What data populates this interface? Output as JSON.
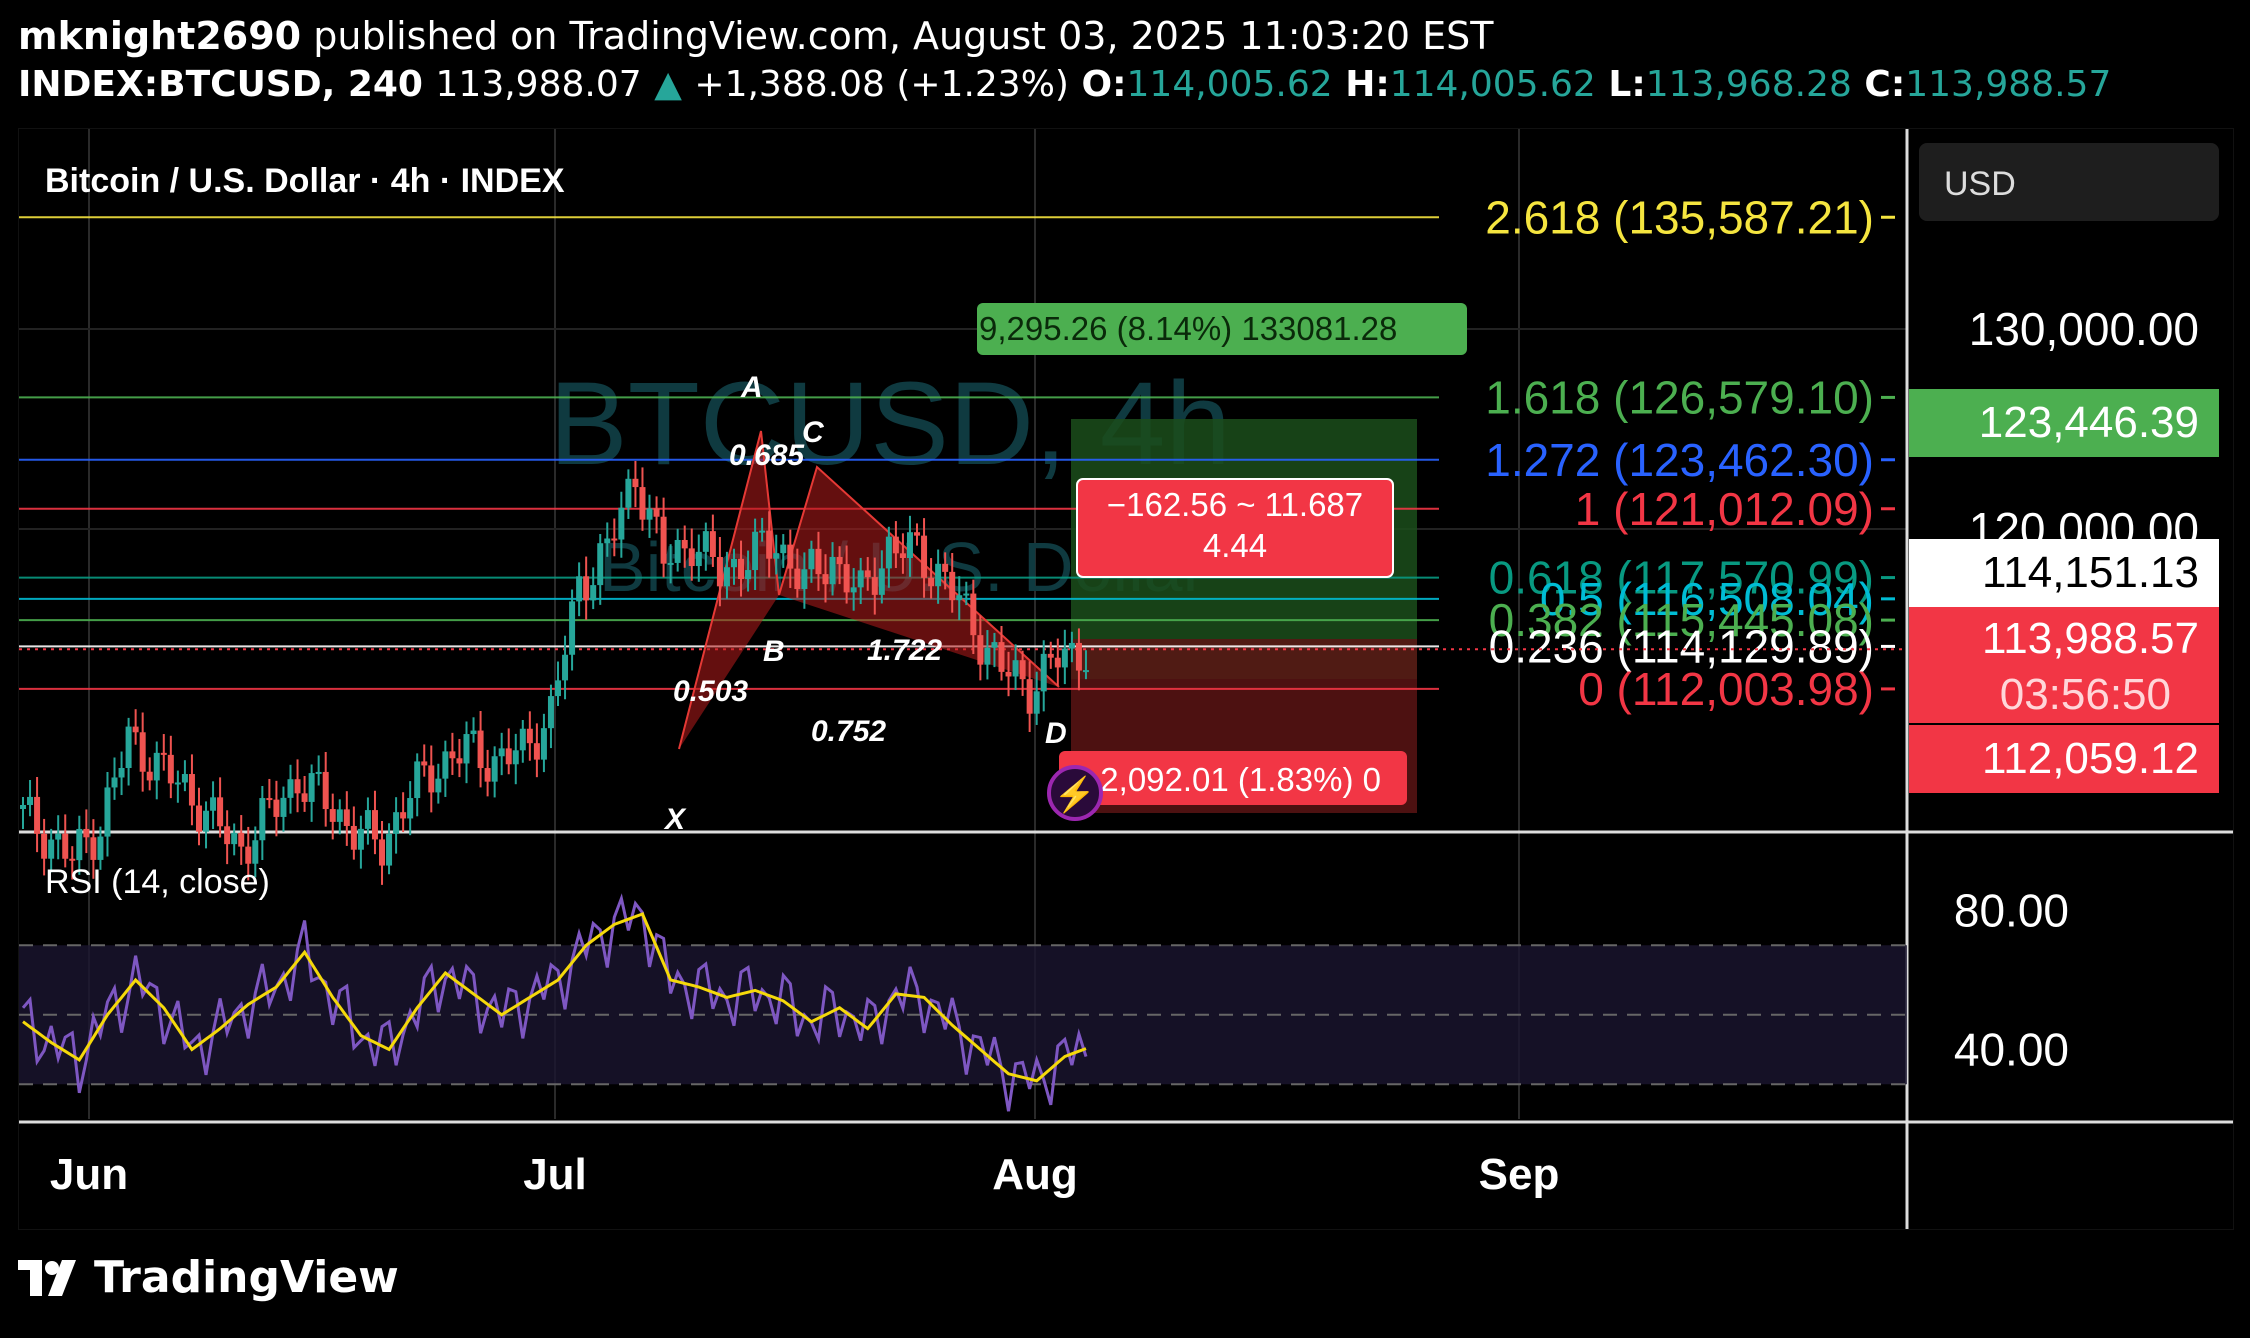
{
  "header": {
    "author": "mknight2690",
    "published_text": "published on TradingView.com, August 03, 2025 11:03:20 EST",
    "symbol": "INDEX:BTCUSD, 240",
    "last": "113,988.07",
    "change_arrow": "▲",
    "change": "+1,388.08 (+1.23%)",
    "o_label": "O:",
    "o": "114,005.62",
    "h_label": "H:",
    "h": "114,005.62",
    "l_label": "L:",
    "l": "113,968.28",
    "c_label": "C:",
    "c": "113,988.57"
  },
  "chart_title": "Bitcoin / U.S. Dollar · 4h · INDEX",
  "watermark": {
    "line1": "BTCUSD, 4h",
    "line2": "Bitcoin / U.S. Dollar"
  },
  "currency_button": "USD",
  "rsi_label": "RSI (14, close)",
  "pattern_labels": {
    "X": "X",
    "A": "A",
    "B": "B",
    "C": "C",
    "D": "D",
    "r_xab": "0.503",
    "r_abc": "0.685",
    "r_bcd": "1.722",
    "r_xad": "0.752"
  },
  "position_boxes": {
    "target": "9,295.26 (8.14%) 133081.28",
    "stop": "−162.56 ~ 11.687",
    "stop_ratio": "4.44",
    "stop_bottom": "2,092.01 (1.83%) 0"
  },
  "fib_levels": [
    {
      "label": "2.618 (135,587.21)",
      "price": 135587.21,
      "color": "#f5e53f"
    },
    {
      "label": "1.618 (126,579.10)",
      "price": 126579.1,
      "color": "#4caf50"
    },
    {
      "label": "1.272 (123,462.30)",
      "price": 123462.3,
      "color": "#2962ff"
    },
    {
      "label": "1 (121,012.09)",
      "price": 121012.09,
      "color": "#f23645"
    },
    {
      "label": "0.618 (117,570.99)",
      "price": 117570.99,
      "color": "#089981"
    },
    {
      "label": "0.5 (116,508.04)",
      "price": 116508.04,
      "color": "#00bcd4"
    },
    {
      "label": "0.382 (115,445.08)",
      "price": 115445.08,
      "color": "#4caf50"
    },
    {
      "label": "0.236 (114,129.89)",
      "price": 114129.89,
      "color": "#ffffff"
    },
    {
      "label": "0 (112,003.98)",
      "price": 112003.98,
      "color": "#f23645"
    }
  ],
  "price_axis": [
    {
      "label": "130,000.00",
      "price": 130000
    },
    {
      "label": "120,000.00",
      "price": 120000
    }
  ],
  "price_tags": {
    "green": "123,446.39",
    "white": "114,151.13",
    "red_price": "113,988.57",
    "red_timer": "03:56:50",
    "red_low": "112,059.12"
  },
  "rsi_axis": [
    {
      "label": "80.00",
      "value": 80
    },
    {
      "label": "40.00",
      "value": 40
    }
  ],
  "time_axis": [
    "Jun",
    "Jul",
    "Aug",
    "Sep"
  ],
  "footer": {
    "brand": "TradingView"
  },
  "colors": {
    "up": "#26a69a",
    "down": "#ef5350",
    "rsi": "#7e57c2",
    "rsi_ma": "#f5d90a",
    "pattern": "#b71c1c"
  },
  "chart_data": {
    "type": "line",
    "title": "Bitcoin / U.S. Dollar · 4h · INDEX",
    "x": [
      "Jun",
      "Jul",
      "Aug",
      "Sep"
    ],
    "series": [
      {
        "name": "Bitcoin / U.S. Dollar",
        "values": [
          106000,
          104800,
          103500,
          105200,
          109500,
          108200,
          107000,
          105400,
          104000,
          105800,
          107500,
          106400,
          104900,
          104200,
          106800,
          108200,
          109000,
          108400,
          108900,
          110800,
          117200,
          118900,
          122800,
          118400,
          119400,
          117800,
          118600,
          119300,
          117400,
          118500,
          116600,
          119100,
          118800,
          117500,
          115100,
          113000,
          112100,
          113500,
          114000
        ]
      },
      {
        "name": "RSI (14, close)",
        "values": [
          48,
          42,
          37,
          50,
          60,
          52,
          40,
          46,
          53,
          58,
          68,
          55,
          44,
          40,
          52,
          62,
          56,
          50,
          55,
          60,
          70,
          76,
          79,
          60,
          58,
          55,
          57,
          54,
          48,
          52,
          46,
          56,
          55,
          47,
          40,
          33,
          31,
          38,
          41
        ]
      }
    ],
    "ylim": [
      105000,
      137000
    ],
    "rsi_ylim": [
      20,
      100
    ]
  }
}
